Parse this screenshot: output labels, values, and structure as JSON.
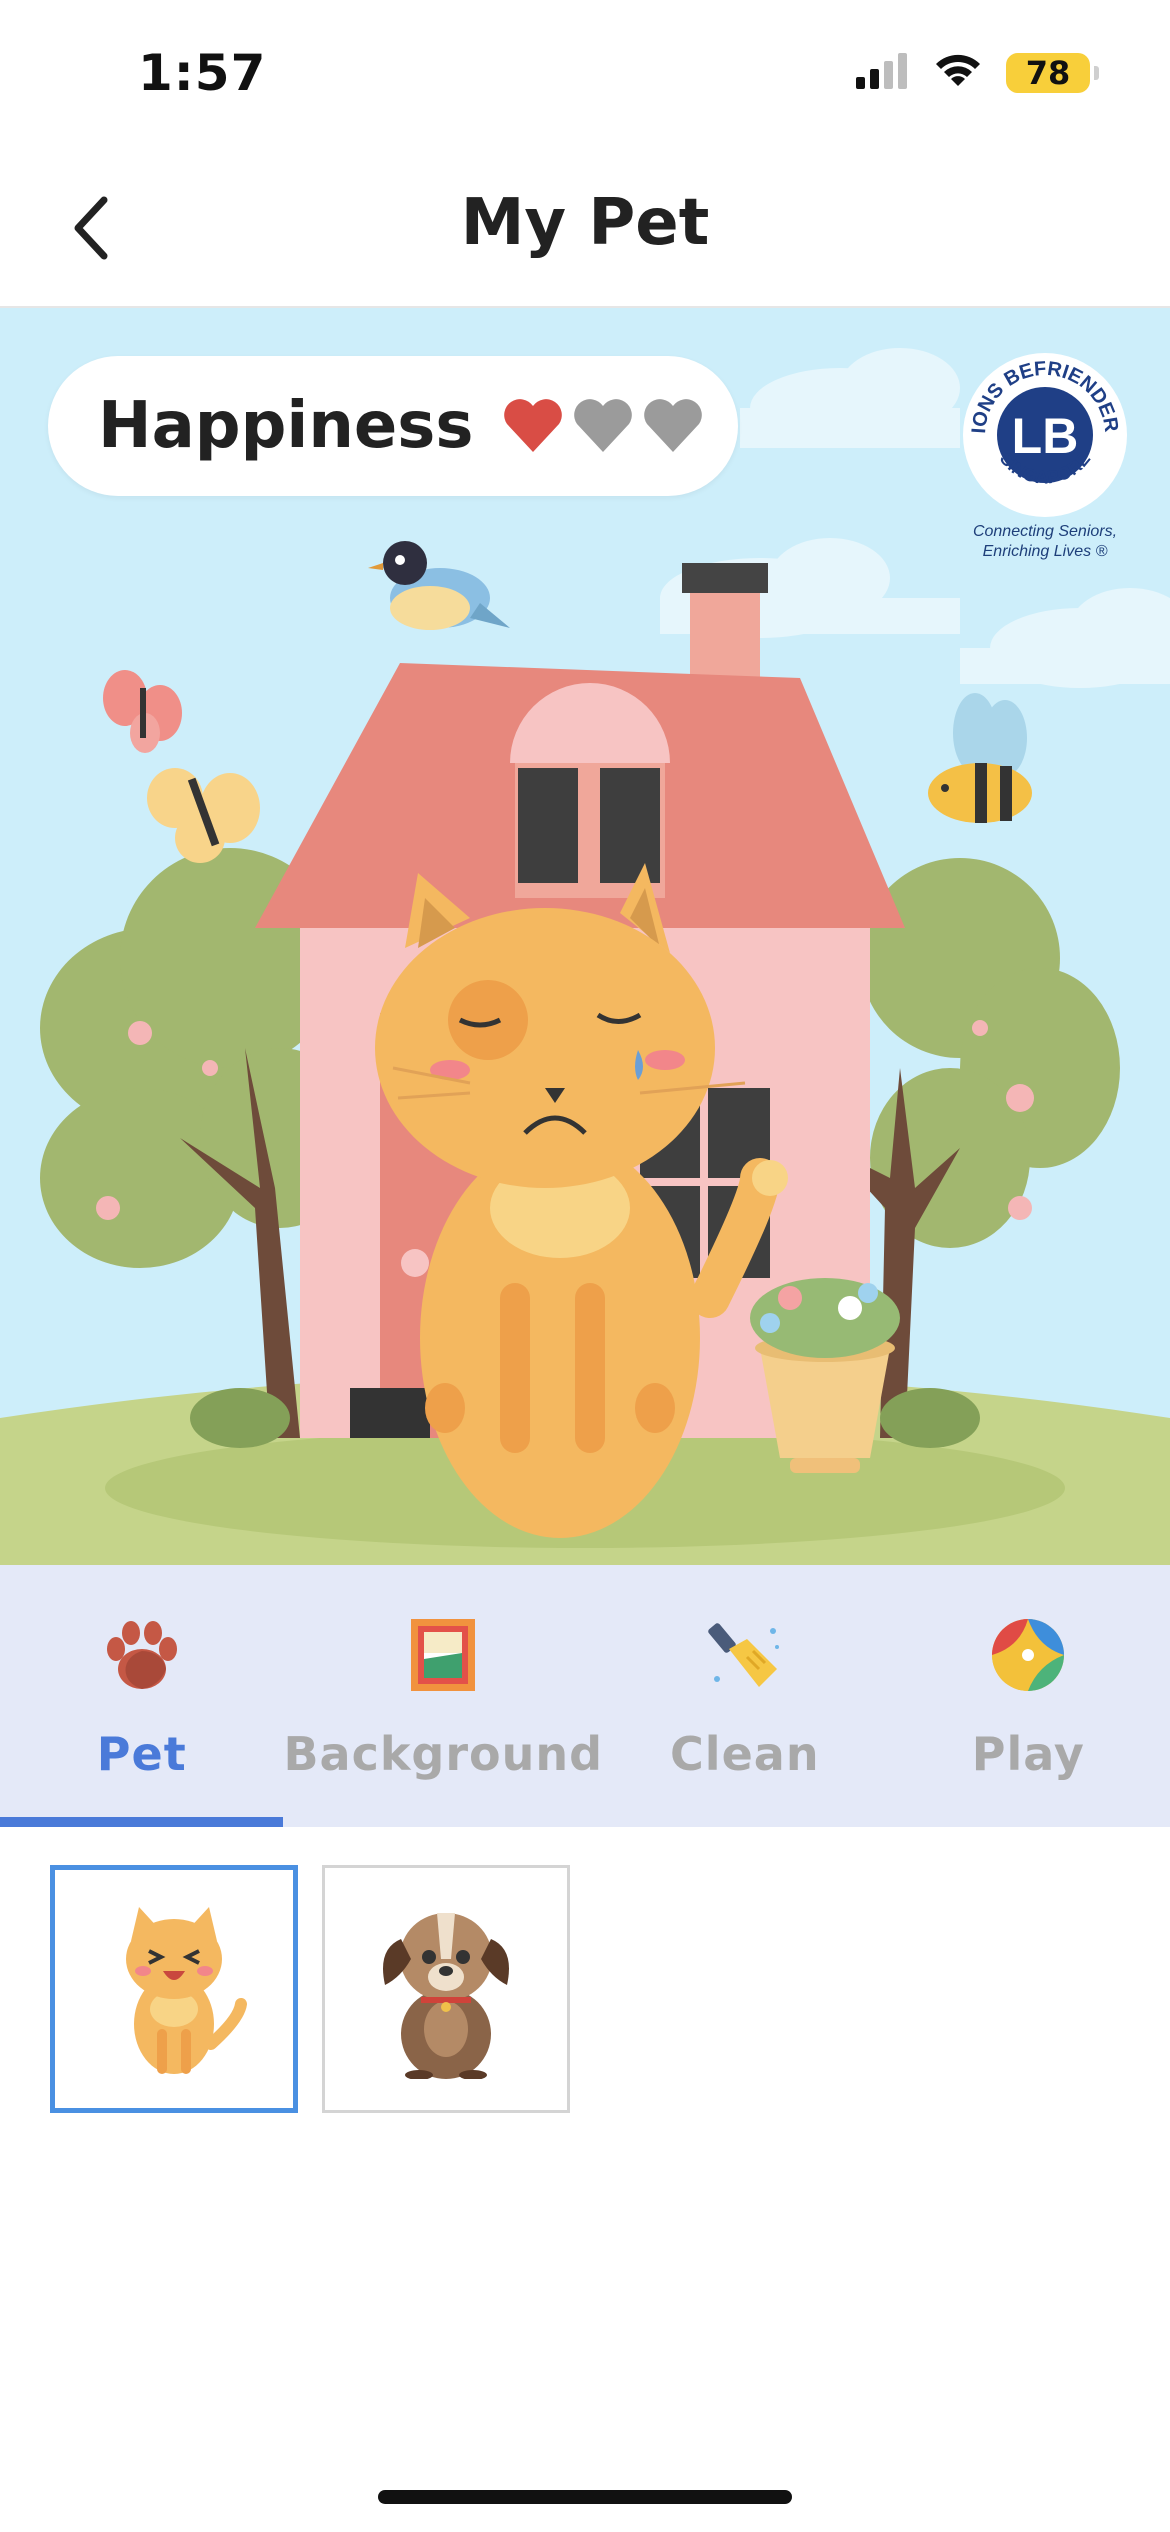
{
  "status_bar": {
    "time": "1:57",
    "battery": "78",
    "icons": [
      "signal-icon",
      "wifi-icon",
      "battery-icon"
    ]
  },
  "nav": {
    "title": "My Pet",
    "back_icon": "chevron-left-icon"
  },
  "scene": {
    "happiness": {
      "label": "Happiness",
      "hearts_filled": 1,
      "hearts_total": 3,
      "heart_colors": {
        "filled": "#d94d45",
        "empty": "#9b9b9b"
      }
    },
    "logo": {
      "arc_top": "LIONS BEFRIENDERS",
      "monogram": "LB",
      "arc_bottom": "SINGAPORE",
      "tagline_line1": "Connecting Seniors,",
      "tagline_line2": "Enriching Lives ®"
    },
    "pet_mood": "sad",
    "colors": {
      "sky": "#cdeefa",
      "grass": "#c5d48a",
      "roof": "#e7887d",
      "house": "#f7c4c3",
      "cat": "#f4b860"
    }
  },
  "tabs": [
    {
      "label": "Pet",
      "icon": "paw-icon",
      "active": true
    },
    {
      "label": "Background",
      "icon": "picture-frame-icon",
      "active": false
    },
    {
      "label": "Clean",
      "icon": "broom-icon",
      "active": false
    },
    {
      "label": "Play",
      "icon": "beach-ball-icon",
      "active": false
    }
  ],
  "pets": [
    {
      "name": "cat",
      "icon": "cat-icon",
      "selected": true
    },
    {
      "name": "dog",
      "icon": "dog-icon",
      "selected": false
    }
  ],
  "accent_color": "#4a7ad9"
}
